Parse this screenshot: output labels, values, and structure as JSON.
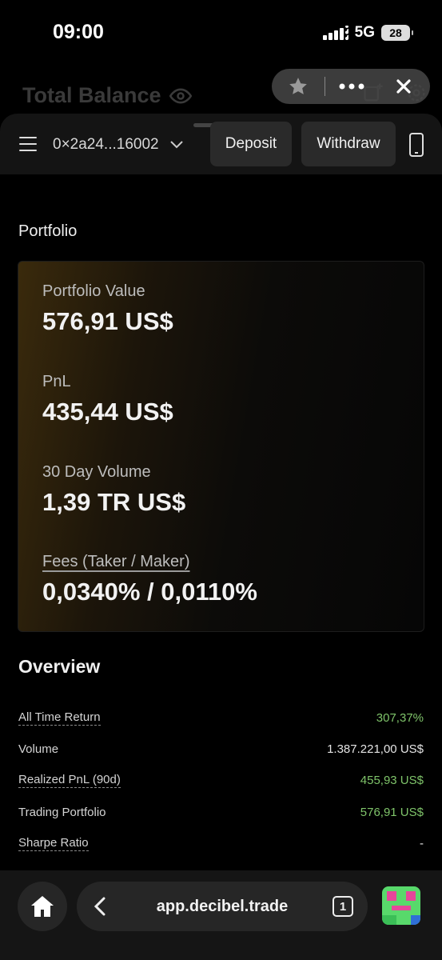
{
  "status_bar": {
    "time": "09:00",
    "network": "5G",
    "battery": "28"
  },
  "background_header": {
    "title": "Total Balance"
  },
  "header": {
    "wallet_address": "0×2a24...16002",
    "deposit_label": "Deposit",
    "withdraw_label": "Withdraw"
  },
  "portfolio": {
    "section_title": "Portfolio",
    "stats": [
      {
        "label": "Portfolio Value",
        "value": "576,91 US$"
      },
      {
        "label": "PnL",
        "value": "435,44 US$"
      },
      {
        "label": "30 Day Volume",
        "value": "1,39 TR US$"
      },
      {
        "label": "Fees (Taker / Maker)",
        "value": "0,0340% / 0,0110%"
      }
    ]
  },
  "overview": {
    "title": "Overview",
    "rows": [
      {
        "label": "All Time Return",
        "value": "307,37%"
      },
      {
        "label": "Volume",
        "value": "1.387.221,00 US$"
      },
      {
        "label": "Realized PnL (90d)",
        "value": "455,93 US$"
      },
      {
        "label": "Trading Portfolio",
        "value": "576,91 US$"
      },
      {
        "label": "Sharpe Ratio",
        "value": "-"
      }
    ]
  },
  "browser": {
    "url": "app.decibel.trade",
    "tab_count": "1"
  },
  "colors": {
    "positive": "#7fc46a",
    "card_gradient_start": "#3a2a0c",
    "bar_bg": "#141414"
  }
}
